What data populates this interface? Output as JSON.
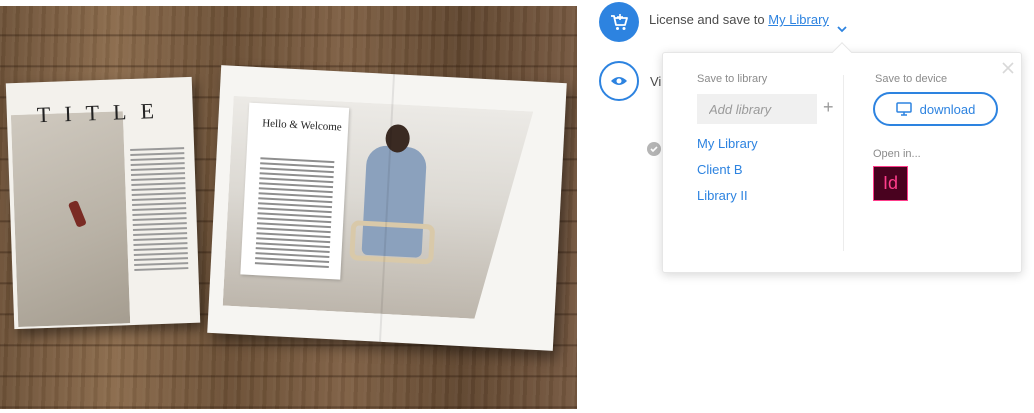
{
  "preview": {
    "title_text": "TITLE",
    "spread_heading": "Hello & Welcome"
  },
  "actions": {
    "license_text": "License and save to ",
    "license_link": "My Library",
    "view_stub": "Vi"
  },
  "popover": {
    "save_to_library_label": "Save to library",
    "add_library_placeholder": "Add library",
    "add_button": "+",
    "libraries": [
      "My Library",
      "Client B",
      "Library II"
    ],
    "save_to_device_label": "Save to device",
    "download_label": "download",
    "open_in_label": "Open in...",
    "indesign_label": "Id"
  },
  "colors": {
    "accent": "#2d83e0",
    "indesign_bg": "#49021f",
    "indesign_fg": "#ff3d8b"
  },
  "icons": [
    "cart-icon",
    "eye-icon",
    "check-icon",
    "chevron-down-icon",
    "close-icon",
    "monitor-icon"
  ]
}
